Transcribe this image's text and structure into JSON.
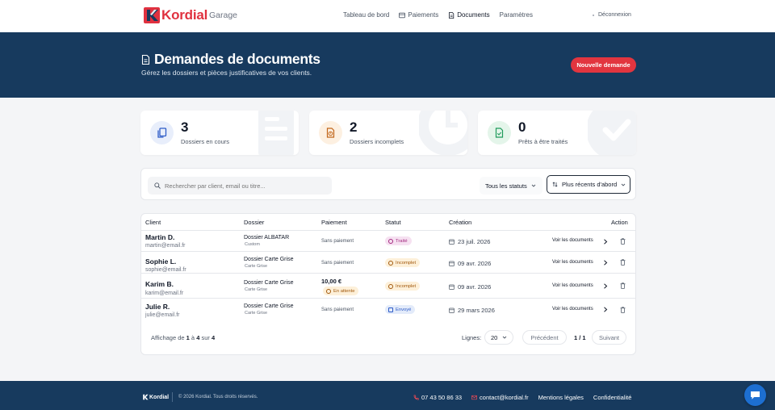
{
  "brand": {
    "name": "Kordial",
    "subtitle": "Garage",
    "red": "#e0313f",
    "navy": "#173a5e"
  },
  "nav": {
    "items": [
      {
        "label": "Tableau de bord",
        "icon": ""
      },
      {
        "label": "Paiements",
        "icon": "card-icon"
      },
      {
        "label": "Documents",
        "icon": "document-icon",
        "active": true
      },
      {
        "label": "Paramètres",
        "icon": ""
      }
    ],
    "logout": "Déconnexion"
  },
  "hero": {
    "title": "Demandes de documents",
    "subtitle": "Gérez les dossiers et pièces justificatives de vos clients.",
    "new_button": "Nouvelle demande"
  },
  "stats": [
    {
      "value": "3",
      "label": "Dossiers en cours",
      "icon": "files-icon",
      "color": "#2d5bc7"
    },
    {
      "value": "2",
      "label": "Dossiers incomplets",
      "icon": "document-warning-icon",
      "color": "#c2661a"
    },
    {
      "value": "0",
      "label": "Prêts à être traités",
      "icon": "document-check-icon",
      "color": "#1e9a5a"
    }
  ],
  "filters": {
    "search_placeholder": "Rechercher par client, email ou titre...",
    "status": "Tous les statuts",
    "sort": "Plus récents d'abord"
  },
  "table": {
    "headers": {
      "client": "Client",
      "dossier": "Dossier",
      "paiement": "Paiement",
      "statut": "Statut",
      "creation": "Création",
      "action": "Action"
    },
    "action_label": "Voir les documents",
    "rows": [
      {
        "name": "Martin D.",
        "email": "martin@email.fr",
        "dossier": "Dossier ALBATAR",
        "dossier_sub": "Custom",
        "payment": "Sans paiement",
        "amount": "",
        "status": "Traité",
        "status_type": "done",
        "date": "23 juil. 2026"
      },
      {
        "name": "Sophie L.",
        "email": "sophie@email.fr",
        "dossier": "Dossier Carte Grise",
        "dossier_sub": "Carte Grise",
        "payment": "Sans paiement",
        "amount": "",
        "status": "Incomplet",
        "status_type": "incomplete",
        "date": "09 avr. 2026"
      },
      {
        "name": "Karim B.",
        "email": "karim@email.fr",
        "dossier": "Dossier Carte Grise",
        "dossier_sub": "Carte Grise",
        "payment": "En attente",
        "amount": "10,00 €",
        "status": "Incomplet",
        "status_type": "incomplete",
        "date": "09 avr. 2026"
      },
      {
        "name": "Julie R.",
        "email": "julie@email.fr",
        "dossier": "Dossier Carte Grise",
        "dossier_sub": "Carte Grise",
        "payment": "Sans paiement",
        "amount": "",
        "status": "Envoyé",
        "status_type": "sent",
        "date": "29 mars 2026"
      }
    ]
  },
  "pagination": {
    "display_prefix": "Affichage de",
    "from": "1",
    "sep1": "à",
    "to": "4",
    "sep2": "sur",
    "total": "4",
    "lines_label": "Lignes:",
    "lines_value": "20",
    "prev": "Précédent",
    "page": "1 / 1",
    "next": "Suivant"
  },
  "footer": {
    "brand": "Kordial",
    "copyright": "© 2026 Kordial. Tous droits réservés.",
    "phone": "07 43 50 86 33",
    "email": "contact@kordial.fr",
    "legal": "Mentions légales",
    "privacy": "Confidentialité"
  }
}
